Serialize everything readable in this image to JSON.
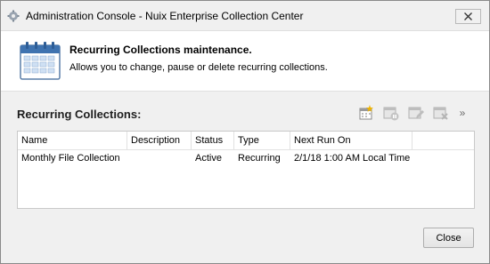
{
  "window": {
    "title": "Administration Console - Nuix Enterprise Collection Center",
    "icon": "admin-console-icon",
    "close_icon": "close-icon"
  },
  "header": {
    "title": "Recurring Collections maintenance.",
    "description": "Allows you to change, pause or delete recurring collections.",
    "icon": "calendar-icon"
  },
  "section": {
    "title": "Recurring Collections:"
  },
  "toolbar": {
    "items": [
      {
        "icon": "calendar-new-icon"
      },
      {
        "icon": "calendar-pause-icon"
      },
      {
        "icon": "calendar-edit-icon"
      },
      {
        "icon": "calendar-delete-icon"
      }
    ],
    "more": "»"
  },
  "table": {
    "columns": [
      "Name",
      "Description",
      "Status",
      "Type",
      "Next Run On"
    ],
    "rows": [
      {
        "name": "Monthly File Collection",
        "description": "",
        "status": "Active",
        "type": "Recurring",
        "next_run_on": "2/1/18 1:00 AM Local Time"
      }
    ]
  },
  "footer": {
    "close_label": "Close"
  }
}
